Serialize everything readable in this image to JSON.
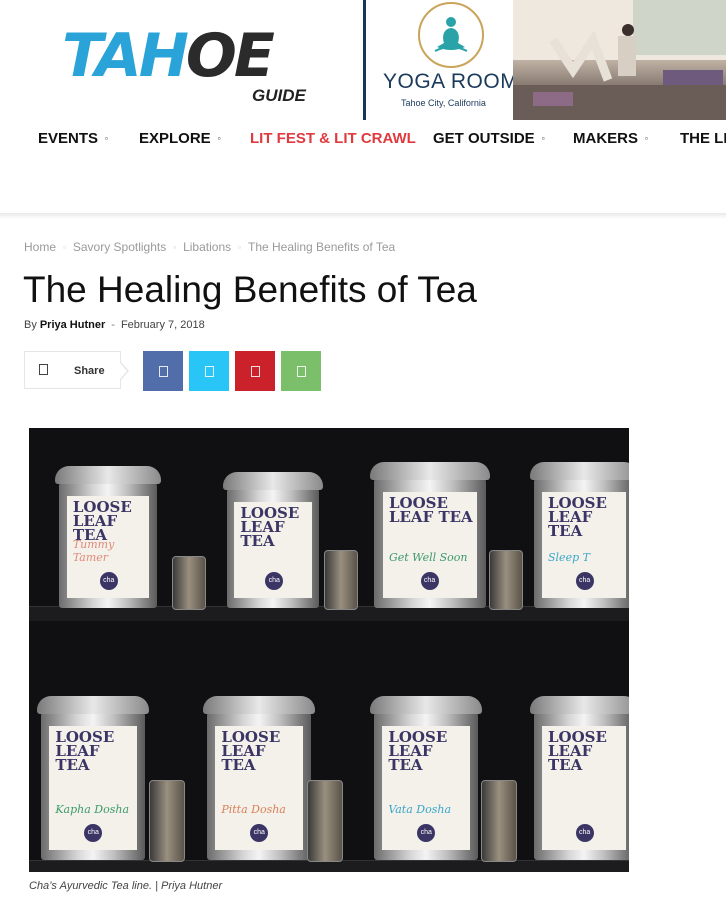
{
  "logo": {
    "text_left": "TAH",
    "text_right": "OE",
    "sub": "GUIDE"
  },
  "ad": {
    "title": "YOGA ROOM",
    "subtitle": "Tahoe City, California"
  },
  "nav": {
    "items": [
      {
        "label": "EVENTS",
        "caret": "▫"
      },
      {
        "label": "EXPLORE",
        "caret": "▫"
      },
      {
        "label": "LIT FEST & LIT CRAWL",
        "caret": ""
      },
      {
        "label": "GET OUTSIDE",
        "caret": "▫"
      },
      {
        "label": "MAKERS",
        "caret": "▫"
      },
      {
        "label": "THE LI",
        "caret": ""
      }
    ],
    "accent_color": "#e03a3e"
  },
  "breadcrumbs": [
    "Home",
    "Savory Spotlights",
    "Libations",
    "The Healing Benefits of Tea"
  ],
  "breadcrumb_sep": "▫",
  "article": {
    "title": "The Healing Benefits of Tea",
    "by": "By",
    "author": "Priya Hutner",
    "date": "February 7, 2018"
  },
  "share": {
    "label": "Share",
    "buttons": [
      {
        "name": "facebook",
        "color": "#516eab"
      },
      {
        "name": "twitter",
        "color": "#29c5f6"
      },
      {
        "name": "pinterest",
        "color": "#ca212a"
      },
      {
        "name": "whatsapp",
        "color": "#7bbf6a"
      }
    ]
  },
  "photo": {
    "jar_label": "LOOSE LEAF TEA",
    "jar_names": [
      "Tummy Tamer",
      "Get Well Soon",
      "Sleep T",
      "Kapha Dosha",
      "Pitta Dosha",
      "Vata Dosha"
    ],
    "brand": "cha"
  },
  "caption": "Cha’s Ayurvedic Tea line. | Priya Hutner"
}
